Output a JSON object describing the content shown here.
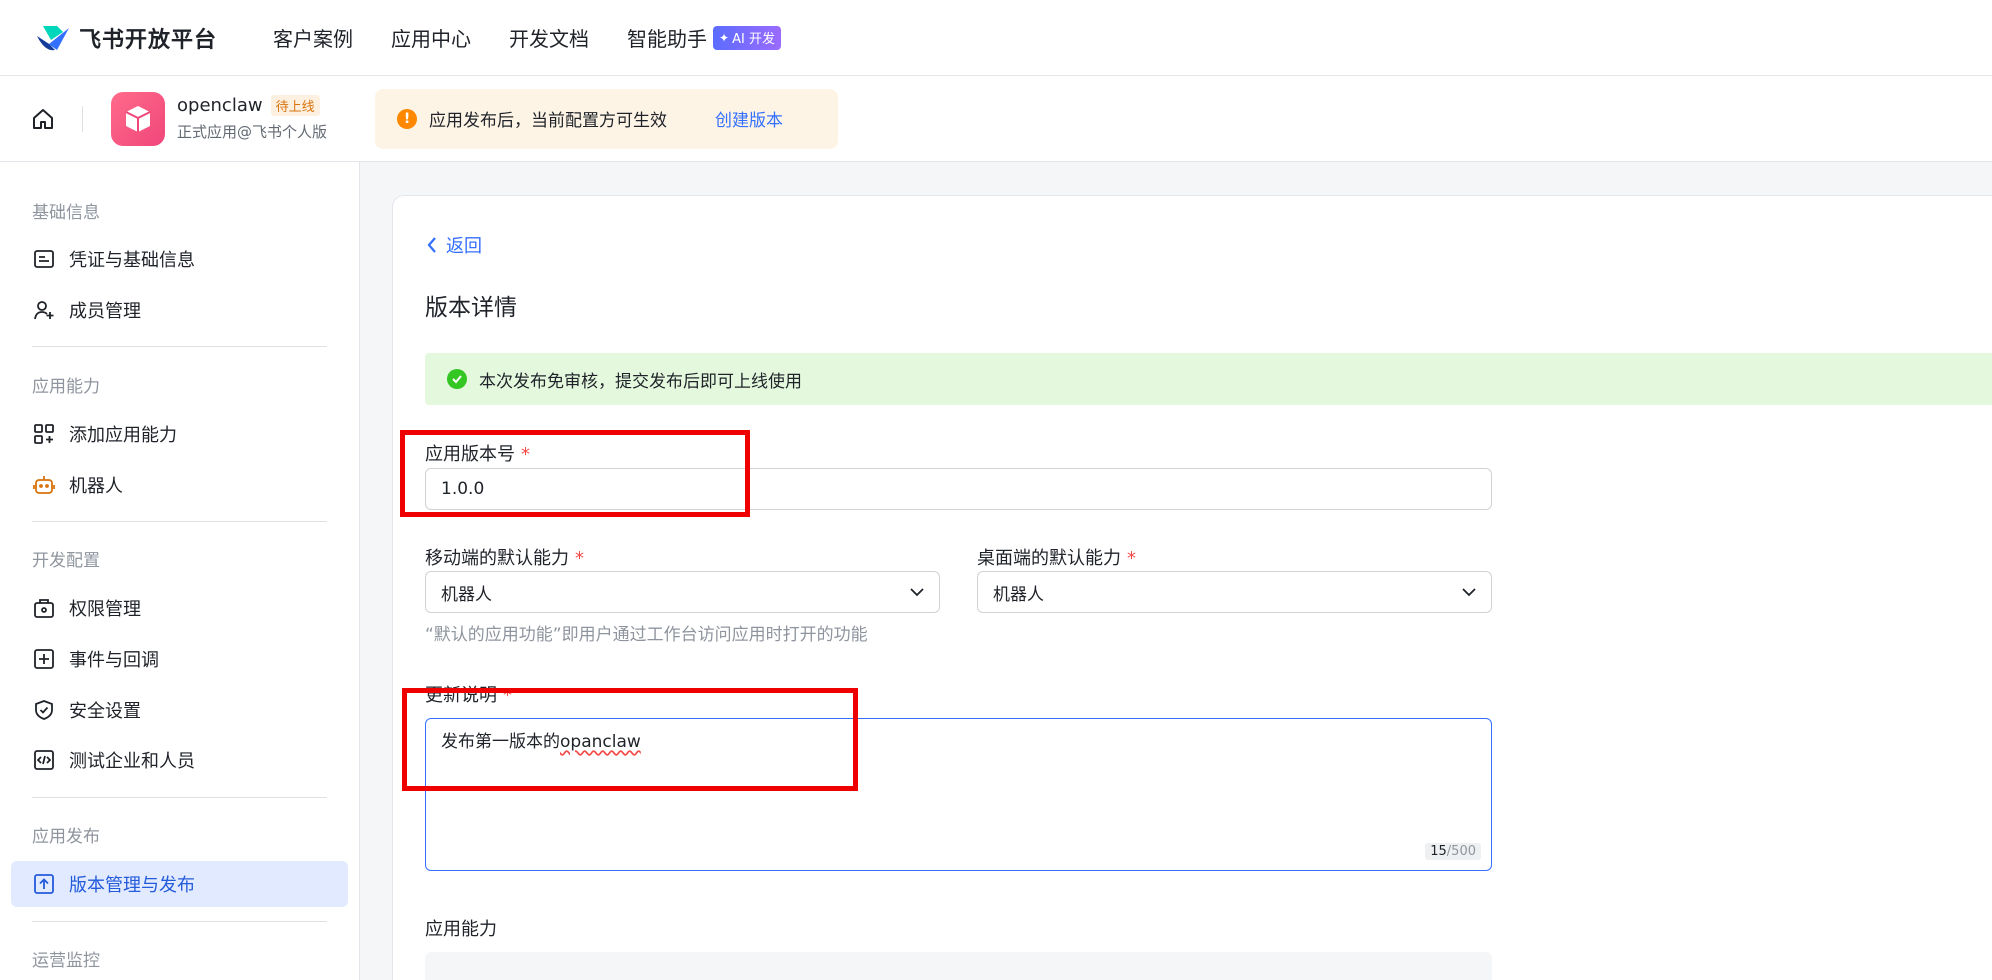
{
  "topnav": {
    "brand": "飞书开放平台",
    "links": [
      "客户案例",
      "应用中心",
      "开发文档",
      "智能助手"
    ],
    "ai_badge": "AI 开发"
  },
  "app": {
    "name": "openclaw",
    "status": "待上线",
    "subtitle": "正式应用@飞书个人版"
  },
  "notice": {
    "text": "应用发布后，当前配置方可生效",
    "link": "创建版本"
  },
  "sidebar": {
    "sections": [
      {
        "title": "基础信息",
        "items": [
          "凭证与基础信息",
          "成员管理"
        ]
      },
      {
        "title": "应用能力",
        "items": [
          "添加应用能力",
          "机器人"
        ]
      },
      {
        "title": "开发配置",
        "items": [
          "权限管理",
          "事件与回调",
          "安全设置",
          "测试企业和人员"
        ]
      },
      {
        "title": "应用发布",
        "items": [
          "版本管理与发布"
        ]
      },
      {
        "title": "运营监控",
        "items": []
      }
    ]
  },
  "main": {
    "back": "返回",
    "title": "版本详情",
    "success": "本次发布免审核，提交发布后即可上线使用",
    "version_label": "应用版本号",
    "version_value": "1.0.0",
    "mobile_label": "移动端的默认能力",
    "mobile_value": "机器人",
    "desktop_label": "桌面端的默认能力",
    "desktop_value": "机器人",
    "default_hint": "“默认的应用功能”即用户通过工作台访问应用时打开的功能",
    "notes_label": "更新说明",
    "notes_value_a": "发布第一版本的",
    "notes_value_b": "opanclaw",
    "counter_current": "15",
    "counter_max": "/500",
    "capabilities_label": "应用能力"
  },
  "colors": {
    "accent": "#3370ff",
    "active_bg": "#e1eaff",
    "success_bg": "#e4f8de",
    "notice_bg": "#fef4e6",
    "annotation_red": "#ee0000"
  }
}
